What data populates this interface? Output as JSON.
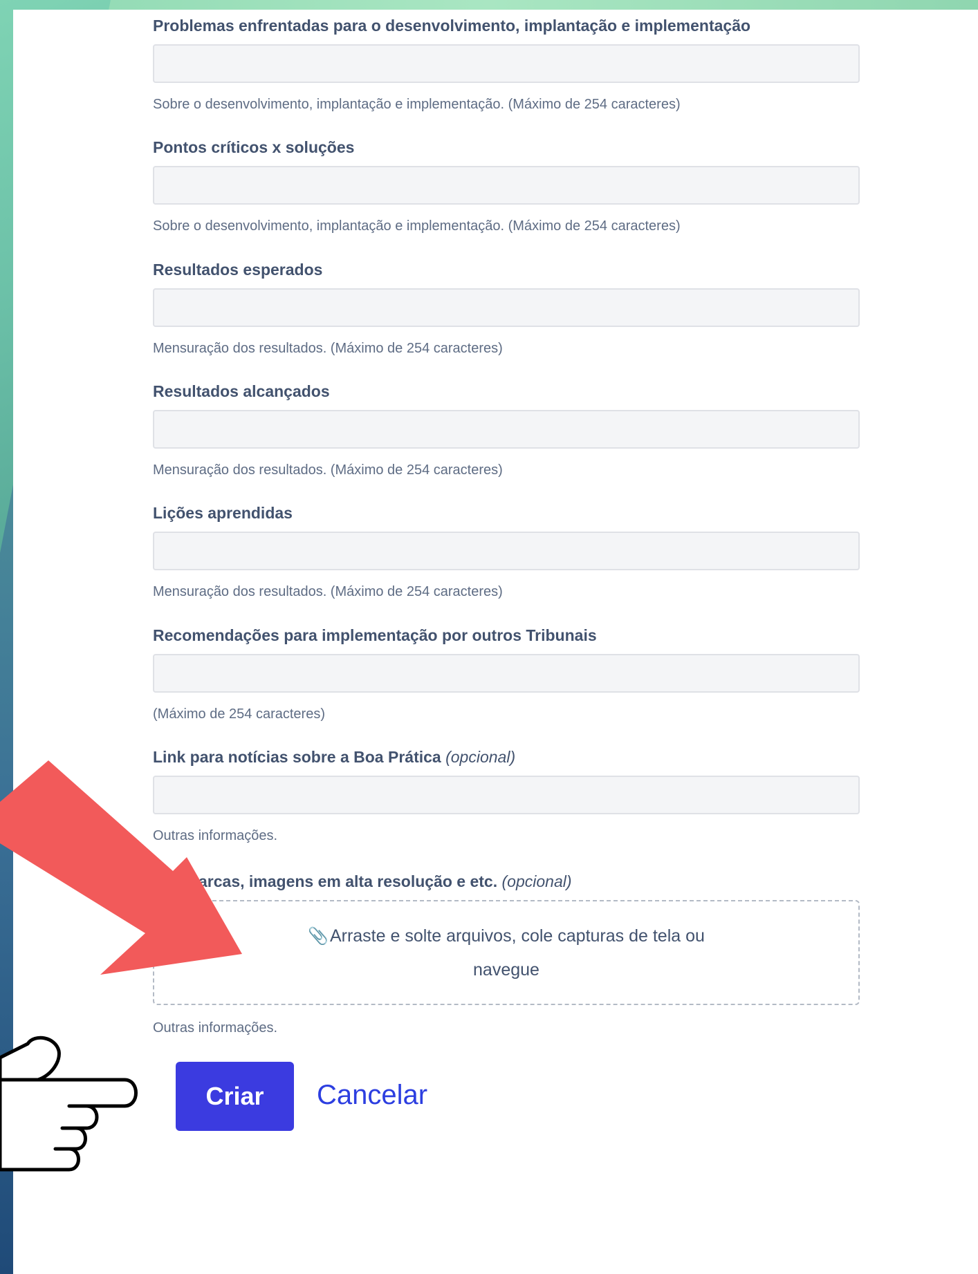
{
  "fields": [
    {
      "label": "Problemas enfrentadas para o desenvolvimento, implantação e implementação",
      "help": "Sobre o desenvolvimento, implantação e implementação. (Máximo de 254 caracteres)"
    },
    {
      "label": "Pontos críticos x soluções",
      "help": "Sobre o desenvolvimento, implantação e implementação. (Máximo de 254 caracteres)"
    },
    {
      "label": "Resultados esperados",
      "help": "Mensuração dos resultados. (Máximo de 254 caracteres)"
    },
    {
      "label": "Resultados alcançados",
      "help": "Mensuração dos resultados. (Máximo de 254 caracteres)"
    },
    {
      "label": "Lições aprendidas",
      "help": "Mensuração dos resultados. (Máximo de 254 caracteres)"
    },
    {
      "label": "Recomendações para implementação por outros Tribunais",
      "help": "(Máximo de 254 caracteres)"
    },
    {
      "label": "Link para notícias sobre a Boa Prática",
      "optional": "(opcional)",
      "help": "Outras informações."
    }
  ],
  "attachments": {
    "label": "arcas, imagens em alta resolução e etc.",
    "optional": "(opcional)",
    "drop_text": "Arraste e solte arquivos, cole capturas de tela ou",
    "browse": "navegue",
    "help": "Outras informações."
  },
  "actions": {
    "create": "Criar",
    "cancel": "Cancelar"
  },
  "colors": {
    "primary": "#3b3be0",
    "link": "#2c3ee0",
    "arrow": "#f25a5a"
  },
  "icons": {
    "attach": "paperclip-icon",
    "pointer": "pointing-hand-icon",
    "arrow": "red-arrow-icon"
  }
}
